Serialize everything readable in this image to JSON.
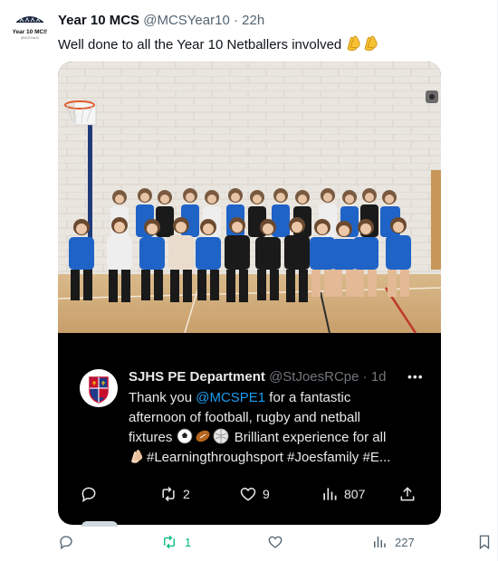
{
  "tweet": {
    "author_name": "Year 10 MCS",
    "author_handle": "@MCSYear10",
    "separator": "·",
    "time": "22h",
    "avatar_label": "Year 10 MCS",
    "avatar_sub": "@MCSYear10",
    "text": "Well done to all the Year 10 Netballers involved",
    "emoji": "clapping-hands"
  },
  "quoted": {
    "author_name": "SJHS PE Department",
    "author_handle": "@StJoesRCpe",
    "separator": "·",
    "time": "1d",
    "more_label": "•••",
    "text_lines": [
      {
        "pre": "Thank you ",
        "mention": "@MCSPE1",
        "post": " for a fantastic"
      },
      {
        "text": "afternoon of football, rugby and netball"
      },
      {
        "pre": "fixtures",
        "post": " Brilliant experience for all"
      },
      {
        "text": "#Learningthroughsport #Joesfamily #E..."
      }
    ],
    "emoji": [
      "soccer-ball",
      "rugby-ball",
      "netball"
    ],
    "retweets": "2",
    "likes": "9",
    "views": "807"
  },
  "actions": {
    "retweets": "1",
    "views": "227",
    "retweet_color": "#00ba7c"
  },
  "colors": {
    "accent": "#1d9bf0",
    "card_bg": "#000000",
    "muted": "#536471"
  }
}
